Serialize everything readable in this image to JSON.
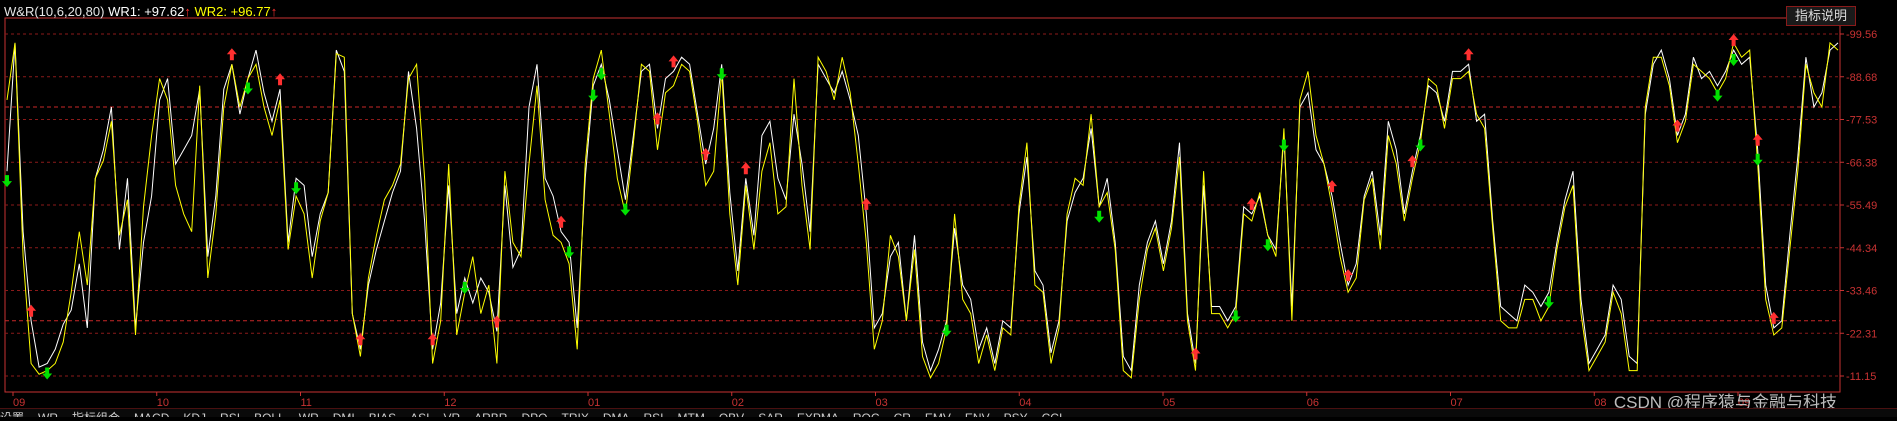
{
  "header": {
    "indicator": "W&R(10,6,20,80)",
    "wr1_label": "WR1:",
    "wr1_value": "+97.62",
    "wr2_label": "WR2:",
    "wr2_value": "+96.77",
    "arrow": "↑"
  },
  "help_button": "指标说明",
  "watermark": "CSDN @程序猿与金融与科技",
  "colors": {
    "background": "#000000",
    "wr1": "#ffffff",
    "wr2": "#ffff00",
    "axis": "#c83232",
    "grid": "#8b1a1a",
    "buy_arrow": "#00e000",
    "sell_arrow": "#ff3030"
  },
  "tabs": [
    "设置",
    "WR",
    "指标组合",
    "MACD",
    "KDJ",
    "RSI",
    "BOLL",
    "WR",
    "DMI",
    "BIAS",
    "ASI",
    "VR",
    "ARBR",
    "DPO",
    "TRIX",
    "DMA",
    "RSI",
    "MTM",
    "OBV",
    "SAR",
    "EXPMA",
    "ROC",
    "CR",
    "EMV",
    "ENV",
    "PSY",
    "CCI"
  ],
  "chart_data": {
    "type": "line",
    "title": "W&R(10,6,20,80)",
    "ylim": [
      0,
      105
    ],
    "y_ticks": [
      "99.56",
      "88.68",
      "77.53",
      "66.38",
      "55.49",
      "44.34",
      "33.46",
      "22.31",
      "11.15"
    ],
    "x_ticks": [
      "09",
      "10",
      "11",
      "12",
      "01",
      "02",
      "03",
      "04",
      "05",
      "06",
      "07",
      "08",
      "09"
    ],
    "grid": true,
    "ref_lines": [
      80,
      20
    ],
    "series": [
      {
        "name": "WR1",
        "values": [
          62,
          98,
          45,
          20,
          7,
          8,
          12,
          19,
          23,
          36,
          18,
          60,
          68,
          80,
          40,
          60,
          18,
          42,
          55,
          82,
          88,
          64,
          68,
          72,
          85,
          38,
          55,
          85,
          92,
          78,
          88,
          96,
          84,
          76,
          85,
          42,
          60,
          58,
          38,
          50,
          56,
          96,
          90,
          22,
          12,
          30,
          40,
          48,
          56,
          62,
          90,
          74,
          48,
          12,
          25,
          58,
          22,
          32,
          25,
          32,
          28,
          17,
          58,
          35,
          40,
          80,
          92,
          60,
          55,
          45,
          42,
          18,
          60,
          86,
          92,
          82,
          68,
          54,
          72,
          90,
          92,
          74,
          88,
          90,
          94,
          92,
          78,
          64,
          74,
          92,
          56,
          34,
          60,
          44,
          72,
          76,
          60,
          54,
          78,
          64,
          45,
          92,
          88,
          84,
          90,
          82,
          72,
          50,
          18,
          22,
          38,
          42,
          20,
          44,
          14,
          6,
          12,
          20,
          46,
          30,
          26,
          12,
          18,
          8,
          20,
          18,
          50,
          66,
          34,
          30,
          11,
          20,
          48,
          56,
          60,
          74,
          52,
          60,
          42,
          10,
          6,
          30,
          42,
          48,
          36,
          48,
          70,
          22,
          8,
          58,
          24,
          24,
          20,
          24,
          52,
          50,
          55,
          44,
          40,
          72,
          24,
          80,
          84,
          68,
          64,
          55,
          42,
          30,
          36,
          55,
          62,
          44,
          76,
          68,
          50,
          62,
          72,
          86,
          84,
          76,
          90,
          90,
          92,
          76,
          78,
          48,
          24,
          22,
          20,
          30,
          28,
          24,
          28,
          42,
          54,
          62,
          26,
          8,
          12,
          16,
          30,
          26,
          10,
          8,
          78,
          92,
          96,
          88,
          72,
          78,
          94,
          88,
          90,
          86,
          90,
          96,
          92,
          94,
          68,
          30,
          18,
          20,
          44,
          66,
          94,
          80,
          84,
          96,
          98
        ]
      },
      {
        "name": "WR2",
        "values": [
          82,
          98,
          38,
          8,
          5,
          6,
          8,
          14,
          28,
          45,
          30,
          60,
          65,
          76,
          44,
          54,
          16,
          52,
          72,
          88,
          82,
          58,
          50,
          45,
          86,
          32,
          50,
          80,
          92,
          80,
          88,
          92,
          80,
          72,
          82,
          40,
          55,
          50,
          32,
          48,
          56,
          95,
          94,
          22,
          10,
          32,
          44,
          54,
          58,
          64,
          88,
          92,
          60,
          8,
          20,
          64,
          16,
          28,
          38,
          22,
          30,
          8,
          62,
          42,
          38,
          64,
          86,
          54,
          44,
          42,
          36,
          12,
          64,
          88,
          96,
          78,
          60,
          50,
          70,
          92,
          90,
          68,
          84,
          86,
          92,
          90,
          76,
          58,
          62,
          90,
          50,
          30,
          58,
          40,
          62,
          70,
          50,
          52,
          88,
          58,
          40,
          94,
          90,
          82,
          94,
          84,
          64,
          42,
          12,
          20,
          44,
          38,
          20,
          40,
          10,
          4,
          8,
          18,
          50,
          26,
          22,
          8,
          16,
          6,
          18,
          16,
          52,
          70,
          30,
          28,
          8,
          18,
          50,
          60,
          58,
          78,
          52,
          56,
          40,
          6,
          4,
          26,
          40,
          46,
          34,
          46,
          66,
          20,
          6,
          62,
          22,
          22,
          18,
          22,
          50,
          48,
          56,
          44,
          38,
          74,
          20,
          82,
          90,
          72,
          64,
          52,
          38,
          28,
          32,
          54,
          60,
          40,
          72,
          64,
          48,
          60,
          70,
          88,
          86,
          74,
          88,
          88,
          90,
          78,
          74,
          46,
          20,
          18,
          18,
          26,
          26,
          20,
          24,
          40,
          52,
          58,
          22,
          6,
          10,
          14,
          28,
          22,
          6,
          6,
          80,
          94,
          94,
          86,
          70,
          76,
          92,
          90,
          88,
          84,
          88,
          98,
          94,
          96,
          64,
          26,
          16,
          18,
          40,
          62,
          92,
          84,
          80,
          98,
          96
        ]
      }
    ],
    "buy_signals": [
      0,
      5,
      30,
      36,
      57,
      70,
      73,
      74,
      77,
      89,
      117,
      136,
      153,
      157,
      159,
      176,
      192,
      213,
      215,
      218
    ],
    "sell_signals": [
      3,
      28,
      34,
      44,
      53,
      61,
      69,
      81,
      83,
      87,
      92,
      107,
      148,
      155,
      165,
      167,
      175,
      182,
      208,
      215,
      218,
      220
    ]
  }
}
